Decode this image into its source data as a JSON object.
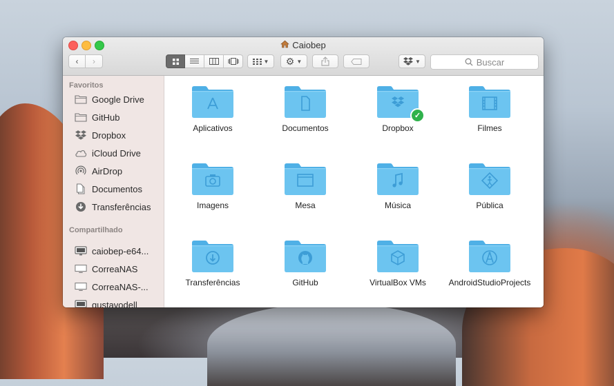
{
  "window": {
    "title": "Caiobep",
    "title_icon": "home-icon"
  },
  "toolbar": {
    "back_icon": "chevron-left-icon",
    "forward_icon": "chevron-right-icon",
    "view_modes": [
      "icon-view",
      "list-view",
      "column-view",
      "cover-flow-view"
    ],
    "arrange_icon": "arrange-grid-icon",
    "action_icon": "gear-icon",
    "share_icon": "share-icon",
    "tag_icon": "tag-icon",
    "dropbox_icon": "dropbox-icon",
    "search_placeholder": "Buscar"
  },
  "sidebar": {
    "favorites_title": "Favoritos",
    "favorites": [
      {
        "label": "Google Drive",
        "icon": "folder-icon"
      },
      {
        "label": "GitHub",
        "icon": "folder-icon"
      },
      {
        "label": "Dropbox",
        "icon": "dropbox-icon"
      },
      {
        "label": "iCloud Drive",
        "icon": "cloud-icon"
      },
      {
        "label": "AirDrop",
        "icon": "airdrop-icon"
      },
      {
        "label": "Documentos",
        "icon": "document-icon"
      },
      {
        "label": "Transferências",
        "icon": "download-icon"
      }
    ],
    "shared_title": "Compartilhado",
    "shared": [
      {
        "label": "caiobep-e64...",
        "icon": "monitor-icon"
      },
      {
        "label": "CorreaNAS",
        "icon": "display-icon"
      },
      {
        "label": "CorreaNAS-...",
        "icon": "display-icon"
      },
      {
        "label": "gustavodell",
        "icon": "monitor-icon"
      }
    ]
  },
  "files": [
    {
      "name": "Aplicativos",
      "icon": "applications-icon"
    },
    {
      "name": "Documentos",
      "icon": "document-icon"
    },
    {
      "name": "Dropbox",
      "icon": "dropbox-icon",
      "synced": true
    },
    {
      "name": "Filmes",
      "icon": "film-icon"
    },
    {
      "name": "Imagens",
      "icon": "camera-icon"
    },
    {
      "name": "Mesa",
      "icon": "desktop-icon"
    },
    {
      "name": "Música",
      "icon": "music-icon"
    },
    {
      "name": "Pública",
      "icon": "public-icon"
    },
    {
      "name": "Transferências",
      "icon": "download-icon"
    },
    {
      "name": "GitHub",
      "icon": "github-icon"
    },
    {
      "name": "VirtualBox VMs",
      "icon": "virtualbox-icon"
    },
    {
      "name": "AndroidStudioProjects",
      "icon": "android-studio-icon"
    }
  ],
  "colors": {
    "folder": "#6cc4f0",
    "folder_dark": "#4fb0e6",
    "sidebar_bg": "#f0e6e4",
    "sync_badge": "#2fb24c"
  }
}
